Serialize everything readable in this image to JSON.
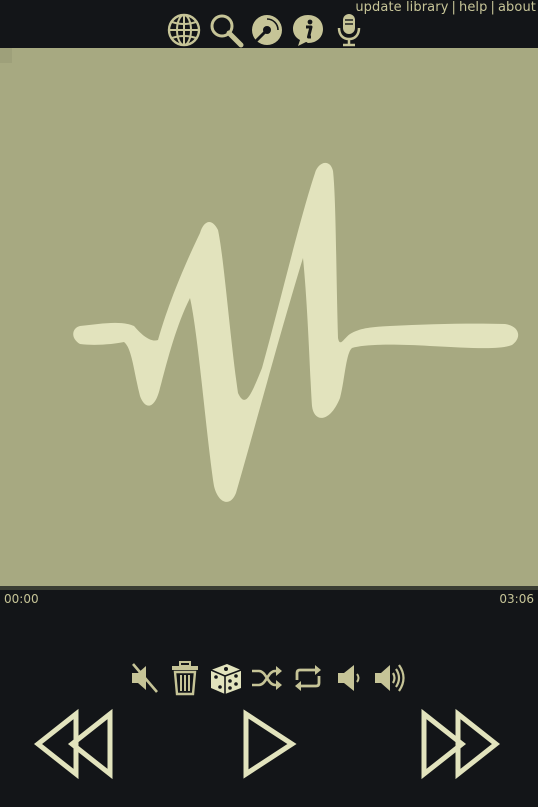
{
  "header": {
    "links": [
      {
        "label": "update library"
      },
      {
        "label": "help"
      },
      {
        "label": "about"
      }
    ],
    "separator": "|",
    "icons": [
      "globe-icon",
      "search-icon",
      "disc-icon",
      "info-icon",
      "microphone-icon"
    ]
  },
  "player": {
    "elapsed": "00:00",
    "duration": "03:06",
    "progress_fraction": 0.0
  },
  "controls": {
    "icons": [
      "mute-icon",
      "trash-icon",
      "dice-icon",
      "shuffle-icon",
      "repeat-icon",
      "volume-down-icon",
      "volume-up-icon"
    ],
    "transport": [
      "rewind-icon",
      "play-icon",
      "fast-forward-icon"
    ]
  },
  "colors": {
    "background": "#131518",
    "accent": "#c6c497",
    "art_background": "#a7a981",
    "waveform": "#e2e3bd"
  }
}
